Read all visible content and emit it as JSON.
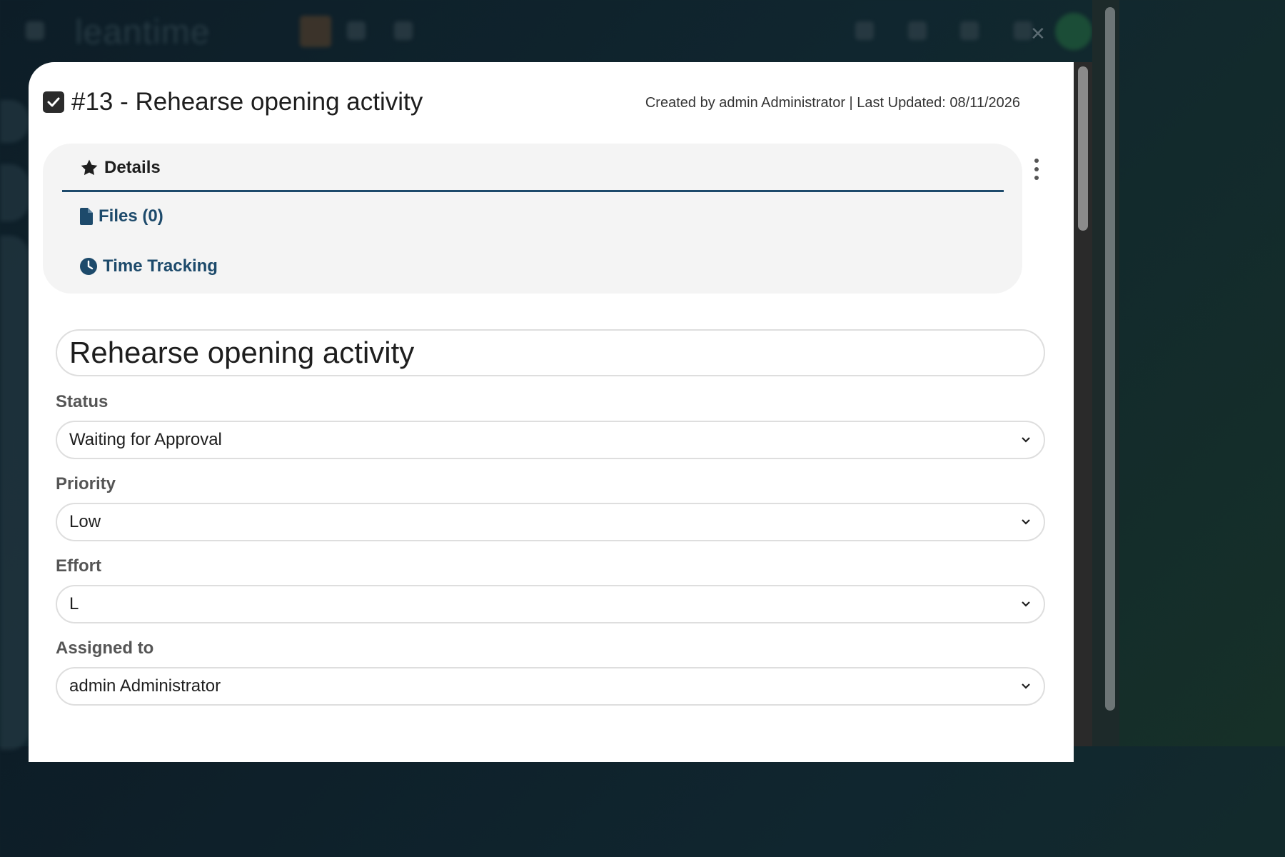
{
  "background": {
    "logo_text": "leantime"
  },
  "ticket": {
    "title": "#13 - Rehearse opening activity",
    "meta": "Created by admin Administrator | Last Updated: 08/11/2026",
    "name_value": "Rehearse opening activity"
  },
  "tabs": [
    {
      "label": "Details",
      "icon": "star-icon",
      "active": true
    },
    {
      "label": "Files (0)",
      "icon": "file-icon",
      "active": false
    },
    {
      "label": "Time Tracking",
      "icon": "clock-icon",
      "active": false
    }
  ],
  "fields": {
    "status": {
      "label": "Status",
      "value": "Waiting for Approval"
    },
    "priority": {
      "label": "Priority",
      "value": "Low"
    },
    "effort": {
      "label": "Effort",
      "value": "L"
    },
    "assigned": {
      "label": "Assigned to",
      "value": "admin Administrator"
    }
  },
  "colors": {
    "accent": "#1d4a6b",
    "text": "#1e1e1e",
    "label": "#555555"
  }
}
